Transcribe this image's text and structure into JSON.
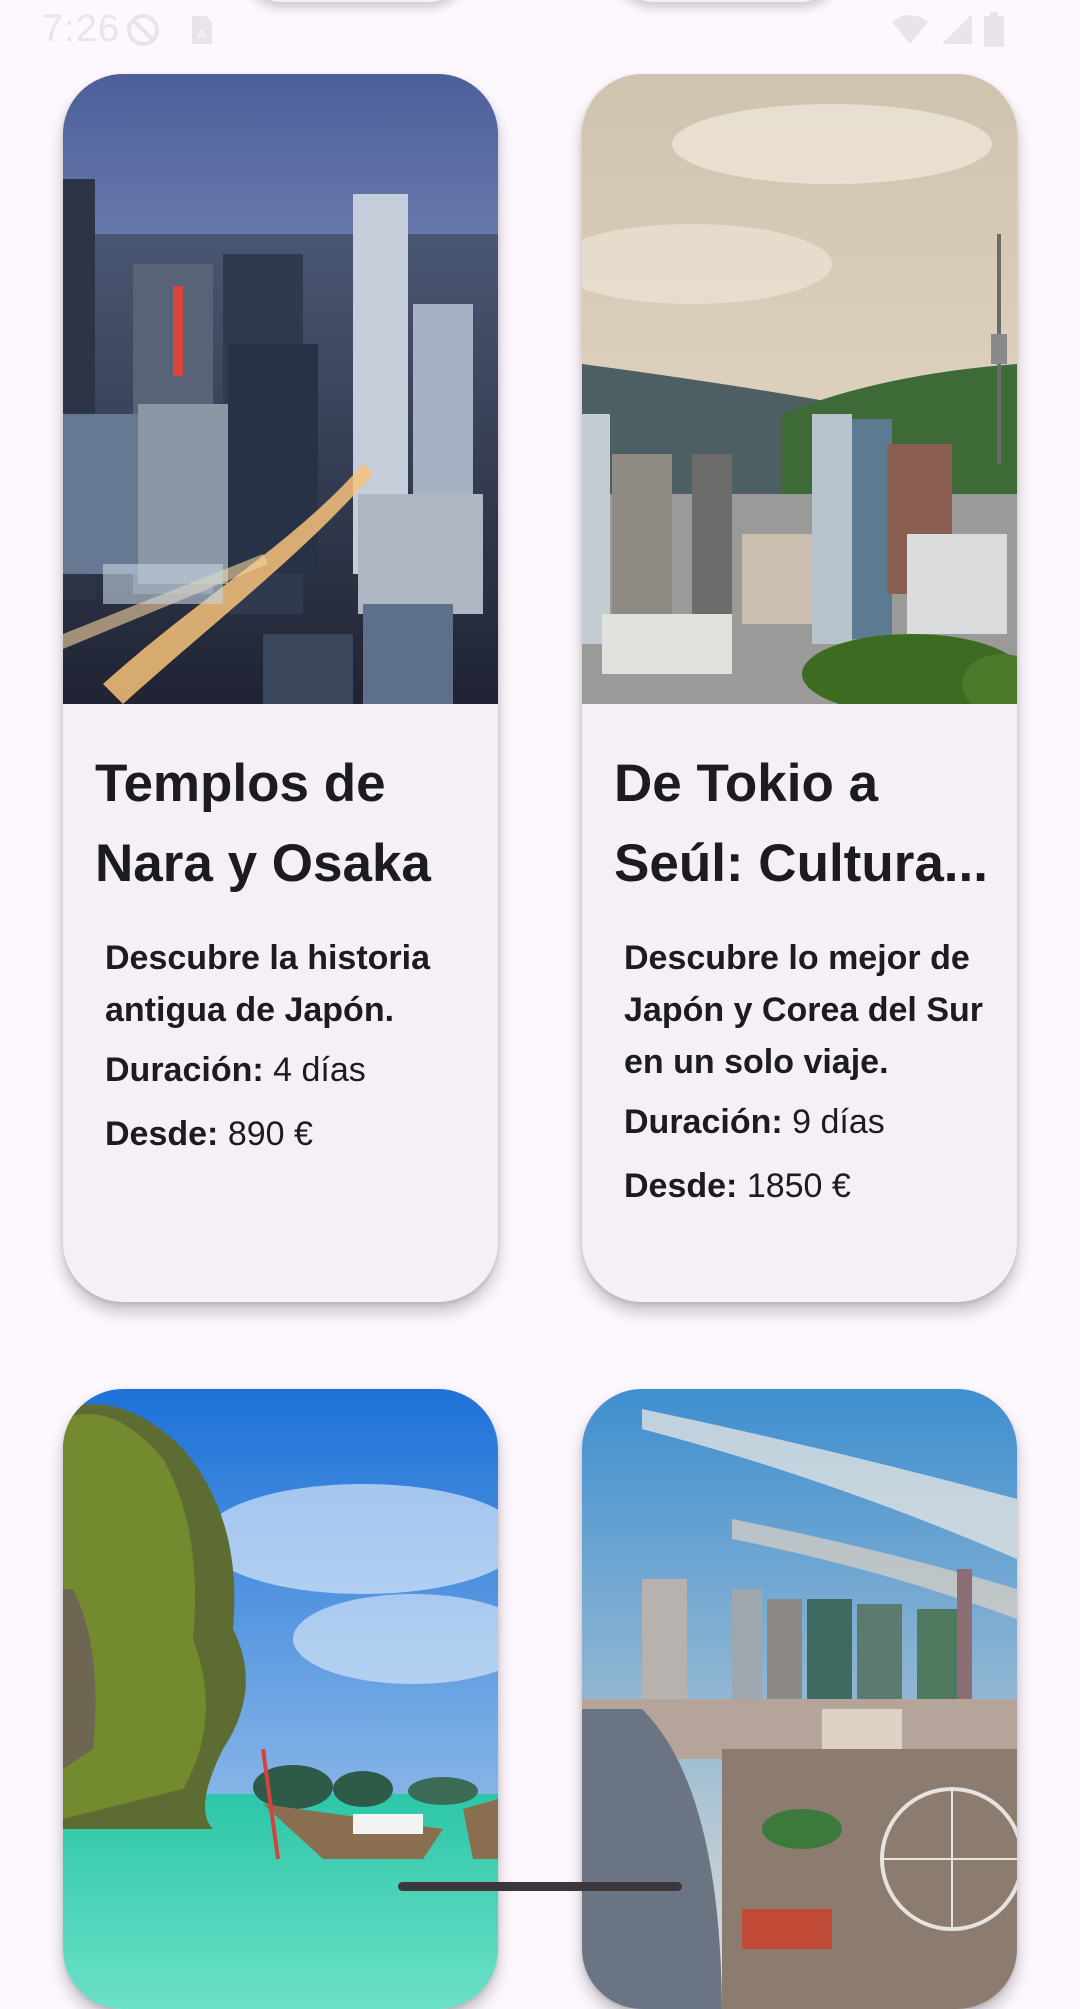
{
  "status_bar": {
    "time": "7:26",
    "icons": [
      "do-not-disturb-icon",
      "sim-icon",
      "wifi-icon",
      "cell-signal-icon",
      "battery-icon"
    ]
  },
  "cards": [
    {
      "title_line1": "Templos de",
      "title_line2": "Nara y Osaka",
      "description": "Descubre la historia antigua de Japón.",
      "duration_label": "Duración:",
      "duration_value": "4 días",
      "price_label": "Desde:",
      "price_value": "890 €",
      "image": "osaka-city-night-image"
    },
    {
      "title_line1": "De Tokio a",
      "title_line2": "Seúl: Cultura...",
      "description": "Descubre lo mejor de Japón y Corea del Sur en un solo viaje.",
      "duration_label": "Duración:",
      "duration_value": "9 días",
      "price_label": "Desde:",
      "price_value": "1850 €",
      "image": "seoul-skyline-image"
    },
    {
      "image": "thailand-beach-longtail-boat-image"
    },
    {
      "image": "bangkok-river-skyline-image"
    }
  ],
  "colors": {
    "background": "#fdf7fe",
    "card": "#f5f0f5",
    "text": "#1d1b20"
  }
}
